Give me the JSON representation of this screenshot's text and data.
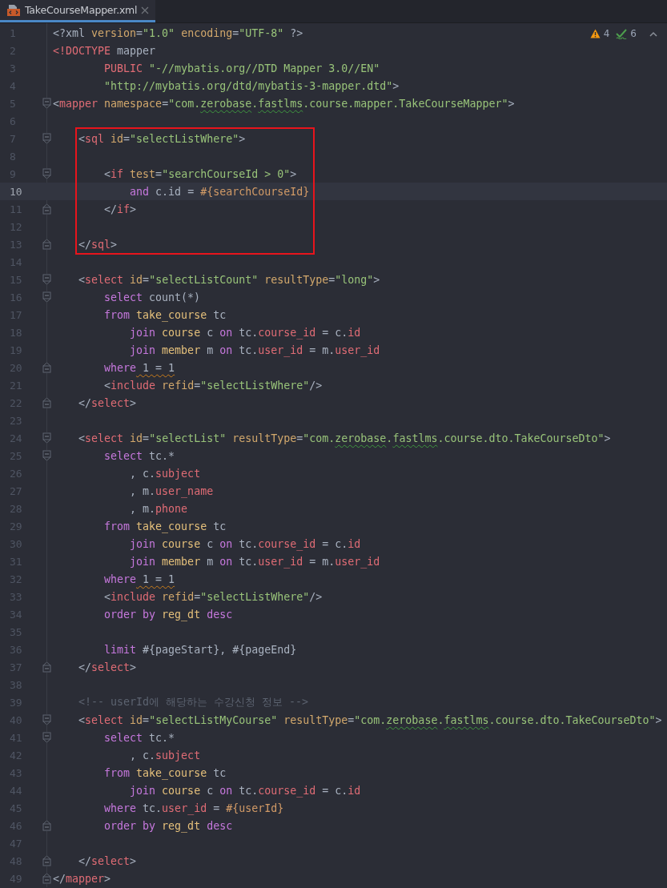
{
  "tabs": [
    {
      "label": "TakeCourseMapper.xml",
      "selected": true
    }
  ],
  "inspections": {
    "warnings": "4",
    "typos": "6"
  },
  "lines": [
    {
      "kind": "line",
      "number": "1",
      "fold_start": false,
      "fold_end": false,
      "current": false,
      "tokens": [
        {
          "kind": "plain",
          "text": "<?xml"
        },
        {
          "kind": "attr",
          "text": " version"
        },
        {
          "kind": "plain",
          "text": "="
        },
        {
          "kind": "string",
          "text": "\"1.0\""
        },
        {
          "kind": "attr",
          "text": " encoding"
        },
        {
          "kind": "plain",
          "text": "="
        },
        {
          "kind": "string",
          "text": "\"UTF-8\""
        },
        {
          "kind": "plain",
          "text": " ?>"
        }
      ]
    },
    {
      "kind": "line",
      "number": "2",
      "fold_start": false,
      "fold_end": false,
      "current": false,
      "tokens": [
        {
          "kind": "tag",
          "text": "<!DOCTYPE"
        },
        {
          "kind": "plain",
          "text": " mapper"
        }
      ]
    },
    {
      "kind": "line",
      "number": "3",
      "fold_start": false,
      "fold_end": false,
      "current": false,
      "tokens": [
        {
          "kind": "tag",
          "text": "        PUBLIC"
        },
        {
          "kind": "string",
          "text": " \"-//mybatis.org//DTD Mapper 3.0//EN\""
        }
      ]
    },
    {
      "kind": "line",
      "number": "4",
      "fold_start": false,
      "fold_end": false,
      "current": false,
      "tokens": [
        {
          "kind": "string",
          "text": "        \"http://mybatis.org/dtd/mybatis-3-mapper.dtd\""
        },
        {
          "kind": "plain",
          "text": ">"
        }
      ]
    },
    {
      "kind": "line",
      "number": "5",
      "fold_start": true,
      "fold_end": false,
      "current": false,
      "tokens": [
        {
          "kind": "plain",
          "text": "<"
        },
        {
          "kind": "tag",
          "text": "mapper"
        },
        {
          "kind": "attr",
          "text": " namespace"
        },
        {
          "kind": "plain",
          "text": "="
        },
        {
          "kind": "string",
          "text": "\"com."
        },
        {
          "kind": "typo",
          "text": "zerobase"
        },
        {
          "kind": "string",
          "text": "."
        },
        {
          "kind": "typo",
          "text": "fastlms"
        },
        {
          "kind": "string",
          "text": ".course.mapper.TakeCourseMapper\""
        },
        {
          "kind": "plain",
          "text": ">"
        }
      ]
    },
    {
      "kind": "line",
      "number": "6",
      "fold_start": false,
      "fold_end": false,
      "current": false
    },
    {
      "kind": "highlight-box",
      "lines": [
        {
          "kind": "line",
          "number": "7",
          "fold_start": true,
          "fold_end": false,
          "current": false,
          "tokens": [
            {
              "kind": "plain",
              "text": "    <"
            },
            {
              "kind": "tag",
              "text": "sql"
            },
            {
              "kind": "attr",
              "text": " id"
            },
            {
              "kind": "plain",
              "text": "="
            },
            {
              "kind": "string",
              "text": "\"selectListWhere\""
            },
            {
              "kind": "plain",
              "text": ">"
            }
          ]
        },
        {
          "kind": "line",
          "number": "8",
          "fold_start": false,
          "fold_end": false,
          "current": false
        },
        {
          "kind": "line",
          "number": "9",
          "fold_start": true,
          "fold_end": false,
          "current": false,
          "tokens": [
            {
              "kind": "plain",
              "text": "        <"
            },
            {
              "kind": "tag",
              "text": "if"
            },
            {
              "kind": "attr",
              "text": " test"
            },
            {
              "kind": "plain",
              "text": "="
            },
            {
              "kind": "string",
              "text": "\"searchCourseId > 0\""
            },
            {
              "kind": "plain",
              "text": ">"
            }
          ]
        },
        {
          "kind": "line",
          "number": "10",
          "fold_start": false,
          "fold_end": false,
          "current": true,
          "tokens": [
            {
              "kind": "keyword",
              "text": "            and"
            },
            {
              "kind": "plain",
              "text": " c.id ="
            },
            {
              "kind": "param",
              "text": " #{searchCourseId}"
            }
          ]
        },
        {
          "kind": "line",
          "number": "11",
          "fold_start": false,
          "fold_end": true,
          "current": false,
          "tokens": [
            {
              "kind": "plain",
              "text": "        </"
            },
            {
              "kind": "tag",
              "text": "if"
            },
            {
              "kind": "plain",
              "text": ">"
            }
          ]
        },
        {
          "kind": "line",
          "number": "12",
          "fold_start": false,
          "fold_end": false,
          "current": false
        },
        {
          "kind": "line",
          "number": "13",
          "fold_start": false,
          "fold_end": true,
          "current": false,
          "tokens": [
            {
              "kind": "plain",
              "text": "    </"
            },
            {
              "kind": "tag",
              "text": "sql"
            },
            {
              "kind": "plain",
              "text": ">"
            }
          ]
        }
      ]
    },
    {
      "kind": "line",
      "number": "14",
      "fold_start": false,
      "fold_end": false,
      "current": false
    },
    {
      "kind": "line",
      "number": "15",
      "fold_start": true,
      "fold_end": false,
      "current": false,
      "tokens": [
        {
          "kind": "plain",
          "text": "    <"
        },
        {
          "kind": "tag",
          "text": "select"
        },
        {
          "kind": "attr",
          "text": " id"
        },
        {
          "kind": "plain",
          "text": "="
        },
        {
          "kind": "string",
          "text": "\"selectListCount\""
        },
        {
          "kind": "attr",
          "text": " resultType"
        },
        {
          "kind": "plain",
          "text": "="
        },
        {
          "kind": "string",
          "text": "\"long\""
        },
        {
          "kind": "plain",
          "text": ">"
        }
      ]
    },
    {
      "kind": "line",
      "number": "16",
      "fold_start": true,
      "fold_end": false,
      "current": false,
      "tokens": [
        {
          "kind": "keyword",
          "text": "        select"
        },
        {
          "kind": "plain",
          "text": " count(*)"
        }
      ]
    },
    {
      "kind": "line",
      "number": "17",
      "fold_start": false,
      "fold_end": false,
      "current": false,
      "tokens": [
        {
          "kind": "keyword",
          "text": "        from"
        },
        {
          "kind": "table",
          "text": " take_course"
        },
        {
          "kind": "plain",
          "text": " tc"
        }
      ]
    },
    {
      "kind": "line",
      "number": "18",
      "fold_start": false,
      "fold_end": false,
      "current": false,
      "tokens": [
        {
          "kind": "keyword",
          "text": "            join"
        },
        {
          "kind": "table",
          "text": " course"
        },
        {
          "kind": "plain",
          "text": " c"
        },
        {
          "kind": "keyword",
          "text": " on"
        },
        {
          "kind": "plain",
          "text": " tc."
        },
        {
          "kind": "column",
          "text": "course_id"
        },
        {
          "kind": "plain",
          "text": " = c."
        },
        {
          "kind": "column",
          "text": "id"
        }
      ]
    },
    {
      "kind": "line",
      "number": "19",
      "fold_start": false,
      "fold_end": false,
      "current": false,
      "tokens": [
        {
          "kind": "keyword",
          "text": "            join"
        },
        {
          "kind": "table",
          "text": " member"
        },
        {
          "kind": "plain",
          "text": " m"
        },
        {
          "kind": "keyword",
          "text": " on"
        },
        {
          "kind": "plain",
          "text": " tc."
        },
        {
          "kind": "column",
          "text": "user_id"
        },
        {
          "kind": "plain",
          "text": " = m."
        },
        {
          "kind": "column",
          "text": "user_id"
        }
      ]
    },
    {
      "kind": "line",
      "number": "20",
      "fold_start": false,
      "fold_end": true,
      "current": false,
      "tokens": [
        {
          "kind": "keyword",
          "text": "        where"
        },
        {
          "kind": "warning",
          "text": " 1 = 1"
        }
      ]
    },
    {
      "kind": "line",
      "number": "21",
      "fold_start": false,
      "fold_end": false,
      "current": false,
      "tokens": [
        {
          "kind": "plain",
          "text": "        <"
        },
        {
          "kind": "tag",
          "text": "include"
        },
        {
          "kind": "attr",
          "text": " refid"
        },
        {
          "kind": "plain",
          "text": "="
        },
        {
          "kind": "string",
          "text": "\"selectListWhere\""
        },
        {
          "kind": "plain",
          "text": "/>"
        }
      ]
    },
    {
      "kind": "line",
      "number": "22",
      "fold_start": false,
      "fold_end": true,
      "current": false,
      "tokens": [
        {
          "kind": "plain",
          "text": "    </"
        },
        {
          "kind": "tag",
          "text": "select"
        },
        {
          "kind": "plain",
          "text": ">"
        }
      ]
    },
    {
      "kind": "line",
      "number": "23",
      "fold_start": false,
      "fold_end": false,
      "current": false
    },
    {
      "kind": "line",
      "number": "24",
      "fold_start": true,
      "fold_end": false,
      "current": false,
      "tokens": [
        {
          "kind": "plain",
          "text": "    <"
        },
        {
          "kind": "tag",
          "text": "select"
        },
        {
          "kind": "attr",
          "text": " id"
        },
        {
          "kind": "plain",
          "text": "="
        },
        {
          "kind": "string",
          "text": "\"selectList\""
        },
        {
          "kind": "attr",
          "text": " resultType"
        },
        {
          "kind": "plain",
          "text": "="
        },
        {
          "kind": "string",
          "text": "\"com."
        },
        {
          "kind": "typo",
          "text": "zerobase"
        },
        {
          "kind": "string",
          "text": "."
        },
        {
          "kind": "typo",
          "text": "fastlms"
        },
        {
          "kind": "string",
          "text": ".course.dto.TakeCourseDto\""
        },
        {
          "kind": "plain",
          "text": ">"
        }
      ]
    },
    {
      "kind": "line",
      "number": "25",
      "fold_start": true,
      "fold_end": false,
      "current": false,
      "tokens": [
        {
          "kind": "keyword",
          "text": "        select"
        },
        {
          "kind": "plain",
          "text": " tc.*"
        }
      ]
    },
    {
      "kind": "line",
      "number": "26",
      "fold_start": false,
      "fold_end": false,
      "current": false,
      "tokens": [
        {
          "kind": "plain",
          "text": "            , c."
        },
        {
          "kind": "column",
          "text": "subject"
        }
      ]
    },
    {
      "kind": "line",
      "number": "27",
      "fold_start": false,
      "fold_end": false,
      "current": false,
      "tokens": [
        {
          "kind": "plain",
          "text": "            , m."
        },
        {
          "kind": "column",
          "text": "user_name"
        }
      ]
    },
    {
      "kind": "line",
      "number": "28",
      "fold_start": false,
      "fold_end": false,
      "current": false,
      "tokens": [
        {
          "kind": "plain",
          "text": "            , m."
        },
        {
          "kind": "column",
          "text": "phone"
        }
      ]
    },
    {
      "kind": "line",
      "number": "29",
      "fold_start": false,
      "fold_end": false,
      "current": false,
      "tokens": [
        {
          "kind": "keyword",
          "text": "        from"
        },
        {
          "kind": "table",
          "text": " take_course"
        },
        {
          "kind": "plain",
          "text": " tc"
        }
      ]
    },
    {
      "kind": "line",
      "number": "30",
      "fold_start": false,
      "fold_end": false,
      "current": false,
      "tokens": [
        {
          "kind": "keyword",
          "text": "            join"
        },
        {
          "kind": "table",
          "text": " course"
        },
        {
          "kind": "plain",
          "text": " c"
        },
        {
          "kind": "keyword",
          "text": " on"
        },
        {
          "kind": "plain",
          "text": " tc."
        },
        {
          "kind": "column",
          "text": "course_id"
        },
        {
          "kind": "plain",
          "text": " = c."
        },
        {
          "kind": "column",
          "text": "id"
        }
      ]
    },
    {
      "kind": "line",
      "number": "31",
      "fold_start": false,
      "fold_end": false,
      "current": false,
      "tokens": [
        {
          "kind": "keyword",
          "text": "            join"
        },
        {
          "kind": "table",
          "text": " member"
        },
        {
          "kind": "plain",
          "text": " m"
        },
        {
          "kind": "keyword",
          "text": " on"
        },
        {
          "kind": "plain",
          "text": " tc."
        },
        {
          "kind": "column",
          "text": "user_id"
        },
        {
          "kind": "plain",
          "text": " = m."
        },
        {
          "kind": "column",
          "text": "user_id"
        }
      ]
    },
    {
      "kind": "line",
      "number": "32",
      "fold_start": false,
      "fold_end": false,
      "current": false,
      "tokens": [
        {
          "kind": "keyword",
          "text": "        where"
        },
        {
          "kind": "warning",
          "text": " 1 = 1"
        }
      ]
    },
    {
      "kind": "line",
      "number": "33",
      "fold_start": false,
      "fold_end": false,
      "current": false,
      "tokens": [
        {
          "kind": "plain",
          "text": "        <"
        },
        {
          "kind": "tag",
          "text": "include"
        },
        {
          "kind": "attr",
          "text": " refid"
        },
        {
          "kind": "plain",
          "text": "="
        },
        {
          "kind": "string",
          "text": "\"selectListWhere\""
        },
        {
          "kind": "plain",
          "text": "/>"
        }
      ]
    },
    {
      "kind": "line",
      "number": "34",
      "fold_start": false,
      "fold_end": false,
      "current": false,
      "tokens": [
        {
          "kind": "keyword",
          "text": "        order by"
        },
        {
          "kind": "table",
          "text": " reg_dt"
        },
        {
          "kind": "keyword",
          "text": " desc"
        }
      ]
    },
    {
      "kind": "line",
      "number": "35",
      "fold_start": false,
      "fold_end": false,
      "current": false
    },
    {
      "kind": "line",
      "number": "36",
      "fold_start": false,
      "fold_end": false,
      "current": false,
      "tokens": [
        {
          "kind": "keyword",
          "text": "        limit"
        },
        {
          "kind": "plain",
          "text": " #{pageStart}, #{pageEnd}"
        }
      ]
    },
    {
      "kind": "line",
      "number": "37",
      "fold_start": false,
      "fold_end": true,
      "current": false,
      "tokens": [
        {
          "kind": "plain",
          "text": "    </"
        },
        {
          "kind": "tag",
          "text": "select"
        },
        {
          "kind": "plain",
          "text": ">"
        }
      ]
    },
    {
      "kind": "line",
      "number": "38",
      "fold_start": false,
      "fold_end": false,
      "current": false
    },
    {
      "kind": "line",
      "number": "39",
      "fold_start": false,
      "fold_end": false,
      "current": false,
      "tokens": [
        {
          "kind": "comment",
          "text": "    <!-- userId에 해당하는 수강신청 정보 -->"
        }
      ]
    },
    {
      "kind": "line",
      "number": "40",
      "fold_start": true,
      "fold_end": false,
      "current": false,
      "tokens": [
        {
          "kind": "plain",
          "text": "    <"
        },
        {
          "kind": "tag",
          "text": "select"
        },
        {
          "kind": "attr",
          "text": " id"
        },
        {
          "kind": "plain",
          "text": "="
        },
        {
          "kind": "string",
          "text": "\"selectListMyCourse\""
        },
        {
          "kind": "attr",
          "text": " resultType"
        },
        {
          "kind": "plain",
          "text": "="
        },
        {
          "kind": "string",
          "text": "\"com."
        },
        {
          "kind": "typo",
          "text": "zerobase"
        },
        {
          "kind": "string",
          "text": "."
        },
        {
          "kind": "typo",
          "text": "fastlms"
        },
        {
          "kind": "string",
          "text": ".course.dto.TakeCourseDto\""
        },
        {
          "kind": "plain",
          "text": ">"
        }
      ]
    },
    {
      "kind": "line",
      "number": "41",
      "fold_start": true,
      "fold_end": false,
      "current": false,
      "tokens": [
        {
          "kind": "keyword",
          "text": "        select"
        },
        {
          "kind": "plain",
          "text": " tc.*"
        }
      ]
    },
    {
      "kind": "line",
      "number": "42",
      "fold_start": false,
      "fold_end": false,
      "current": false,
      "tokens": [
        {
          "kind": "plain",
          "text": "            , c."
        },
        {
          "kind": "column",
          "text": "subject"
        }
      ]
    },
    {
      "kind": "line",
      "number": "43",
      "fold_start": false,
      "fold_end": false,
      "current": false,
      "tokens": [
        {
          "kind": "keyword",
          "text": "        from"
        },
        {
          "kind": "table",
          "text": " take_course"
        },
        {
          "kind": "plain",
          "text": " tc"
        }
      ]
    },
    {
      "kind": "line",
      "number": "44",
      "fold_start": false,
      "fold_end": false,
      "current": false,
      "tokens": [
        {
          "kind": "keyword",
          "text": "            join"
        },
        {
          "kind": "table",
          "text": " course"
        },
        {
          "kind": "plain",
          "text": " c"
        },
        {
          "kind": "keyword",
          "text": " on"
        },
        {
          "kind": "plain",
          "text": " tc."
        },
        {
          "kind": "column",
          "text": "course_id"
        },
        {
          "kind": "plain",
          "text": " = c."
        },
        {
          "kind": "column",
          "text": "id"
        }
      ]
    },
    {
      "kind": "line",
      "number": "45",
      "fold_start": false,
      "fold_end": false,
      "current": false,
      "tokens": [
        {
          "kind": "keyword",
          "text": "        where"
        },
        {
          "kind": "plain",
          "text": " tc."
        },
        {
          "kind": "column",
          "text": "user_id"
        },
        {
          "kind": "plain",
          "text": " ="
        },
        {
          "kind": "param",
          "text": " #{userId}"
        }
      ]
    },
    {
      "kind": "line",
      "number": "46",
      "fold_start": false,
      "fold_end": true,
      "current": false,
      "tokens": [
        {
          "kind": "keyword",
          "text": "        order by"
        },
        {
          "kind": "table",
          "text": " reg_dt"
        },
        {
          "kind": "keyword",
          "text": " desc"
        }
      ]
    },
    {
      "kind": "line",
      "number": "47",
      "fold_start": false,
      "fold_end": false,
      "current": false
    },
    {
      "kind": "line",
      "number": "48",
      "fold_start": false,
      "fold_end": true,
      "current": false,
      "tokens": [
        {
          "kind": "plain",
          "text": "    </"
        },
        {
          "kind": "tag",
          "text": "select"
        },
        {
          "kind": "plain",
          "text": ">"
        }
      ]
    },
    {
      "kind": "line",
      "number": "49",
      "fold_start": false,
      "fold_end": true,
      "current": false,
      "tokens": [
        {
          "kind": "plain",
          "text": "</"
        },
        {
          "kind": "tag",
          "text": "mapper"
        },
        {
          "kind": "plain",
          "text": ">"
        }
      ]
    }
  ]
}
